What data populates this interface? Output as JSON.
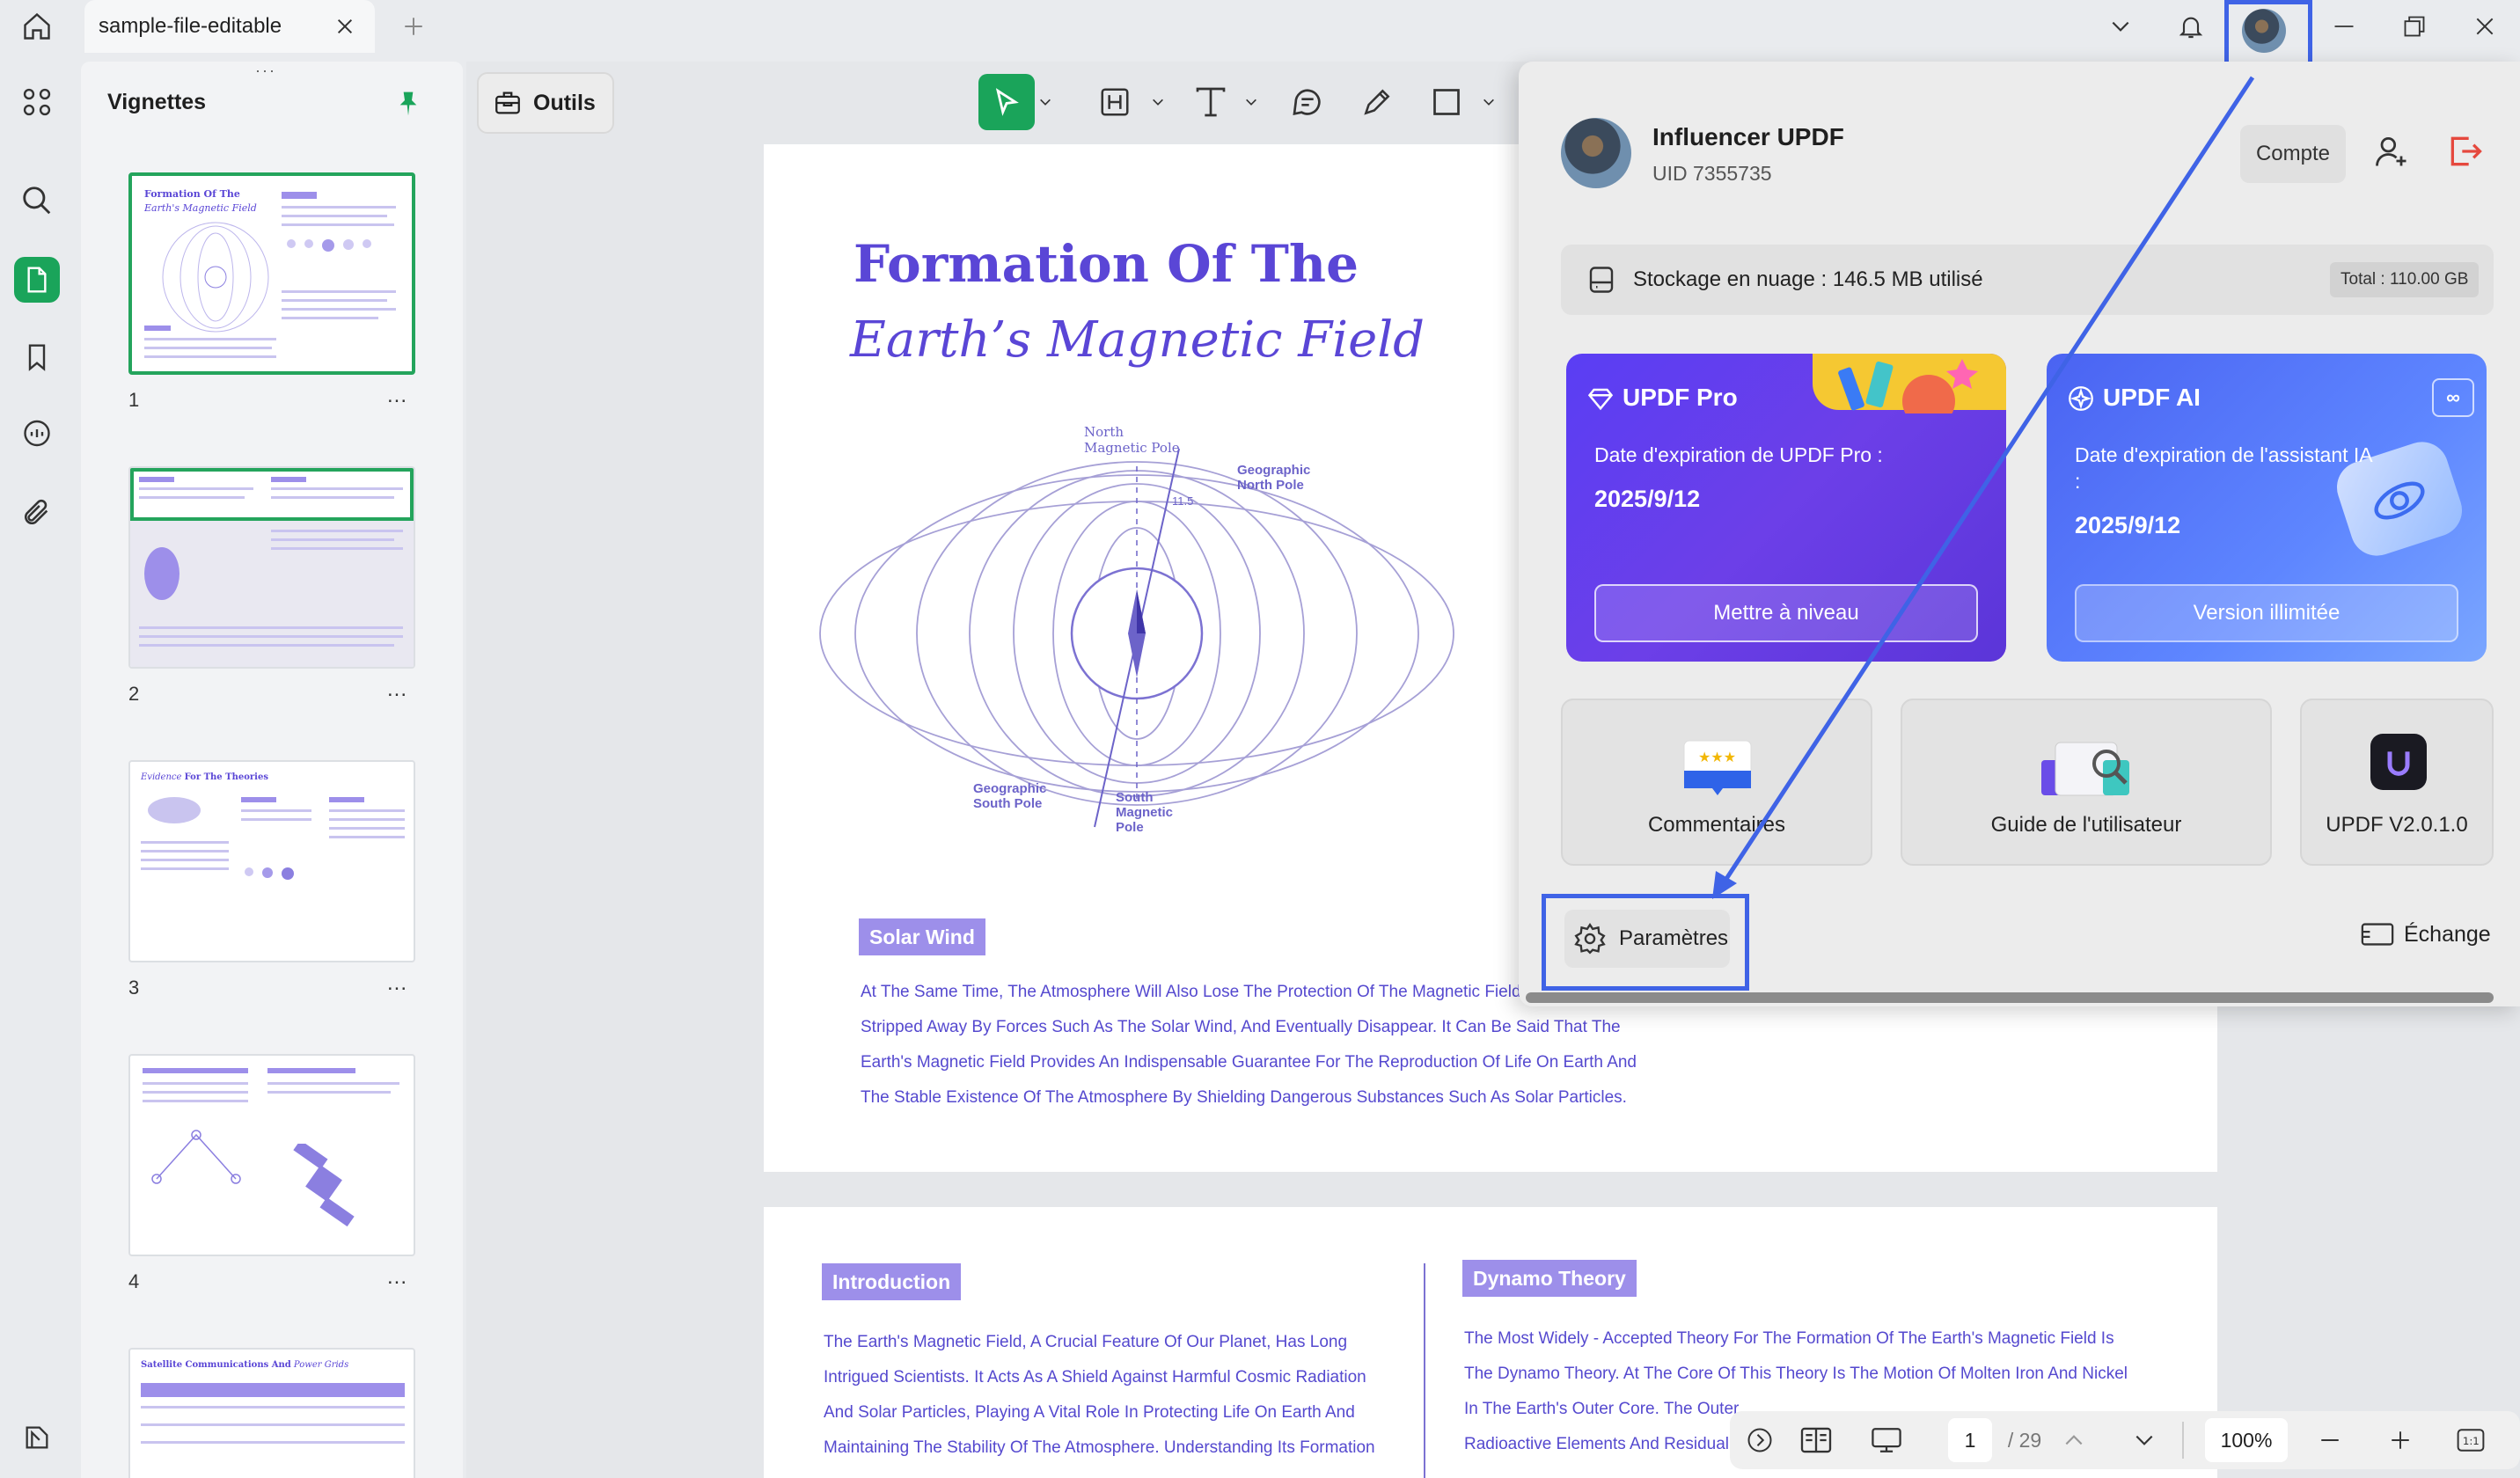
{
  "window": {
    "tab_title": "sample-file-editable",
    "icons": [
      "home-icon",
      "close-icon",
      "plus-icon",
      "chevron-down-icon",
      "bell-icon",
      "minimize-icon",
      "restore-icon",
      "close-window-icon"
    ]
  },
  "left_rail": {
    "icons": [
      "grid-icon",
      "search-icon",
      "page-icon",
      "bookmark-icon",
      "comment-icon",
      "attachment-icon",
      "layers-icon"
    ]
  },
  "thumbnails": {
    "title": "Vignettes",
    "pages": [
      {
        "number": "1",
        "more": "..."
      },
      {
        "number": "2",
        "more": "..."
      },
      {
        "number": "3",
        "more": "..."
      },
      {
        "number": "4",
        "more": "..."
      }
    ]
  },
  "toolbar": {
    "tools_label": "Outils"
  },
  "document": {
    "title_line1": "Formation Of The",
    "title_line2": "Earth’s Magnetic Field",
    "diagram_labels": {
      "north_magnetic": "North Magnetic Pole",
      "geo_north": "Geographic North Pole",
      "angle": "11.5",
      "geo_south": "Geographic South Pole",
      "south_magnetic": "South Magnetic Pole"
    },
    "solar_wind_tag": "Solar Wind",
    "solar_wind_text": [
      "At The Same Time, The Atmosphere Will Also Lose The Protection Of The Magnetic Field",
      "Stripped Away By Forces Such As The Solar Wind, And Eventually Disappear. It Can Be Said That The",
      "Earth's Magnetic Field Provides An Indispensable Guarantee For The Reproduction Of Life On Earth And",
      "The Stable Existence Of The Atmosphere By Shielding Dangerous Substances Such As Solar Particles."
    ],
    "intro_tag": "Introduction",
    "intro_text": [
      "The Earth's Magnetic Field, A Crucial Feature Of Our Planet, Has Long",
      "Intrigued Scientists. It Acts As A Shield Against Harmful Cosmic Radiation",
      "And Solar Particles, Playing A Vital Role In Protecting Life On Earth And",
      "Maintaining The Stability Of The Atmosphere. Understanding Its Formation"
    ],
    "dynamo_tag": "Dynamo Theory",
    "dynamo_text": [
      "The Most Widely - Accepted Theory For The Formation Of The Earth's Magnetic Field Is",
      "The Dynamo Theory. At The Core Of This Theory Is The Motion Of Molten Iron And Nickel",
      "In The Earth's Outer Core. The Outer",
      "Radioactive Elements And Residual I"
    ]
  },
  "account_popup": {
    "user_name": "Influencer UPDF",
    "uid": "UID 7355735",
    "account_button": "Compte",
    "storage_text": "Stockage en nuage : 146.5 MB utilisé",
    "storage_total": "Total : 110.00 GB",
    "pro_card": {
      "title": "UPDF Pro",
      "expiry_label": "Date d'expiration de UPDF Pro :",
      "expiry_date": "2025/9/12",
      "button": "Mettre à niveau"
    },
    "ai_card": {
      "title": "UPDF AI",
      "expiry_label": "Date d'expiration de l'assistant IA",
      "expiry_colon": ":",
      "expiry_date": "2025/9/12",
      "button": "Version illimitée",
      "badge": "∞"
    },
    "tiles": [
      {
        "label": "Commentaires"
      },
      {
        "label": "Guide de l'utilisateur"
      },
      {
        "label": "UPDF V2.0.1.0"
      }
    ],
    "settings_button": "Paramètres",
    "exchange_button": "Échange"
  },
  "bottom_bar": {
    "current_page": "1",
    "total_pages": "/ 29",
    "zoom": "100%"
  },
  "colors": {
    "accent_green": "#1aa45a",
    "doc_purple": "#5a46d6",
    "highlight_blue": "#3f63e6",
    "pro_purple": "#5a3ef4",
    "ai_blue": "#4a63f2"
  }
}
